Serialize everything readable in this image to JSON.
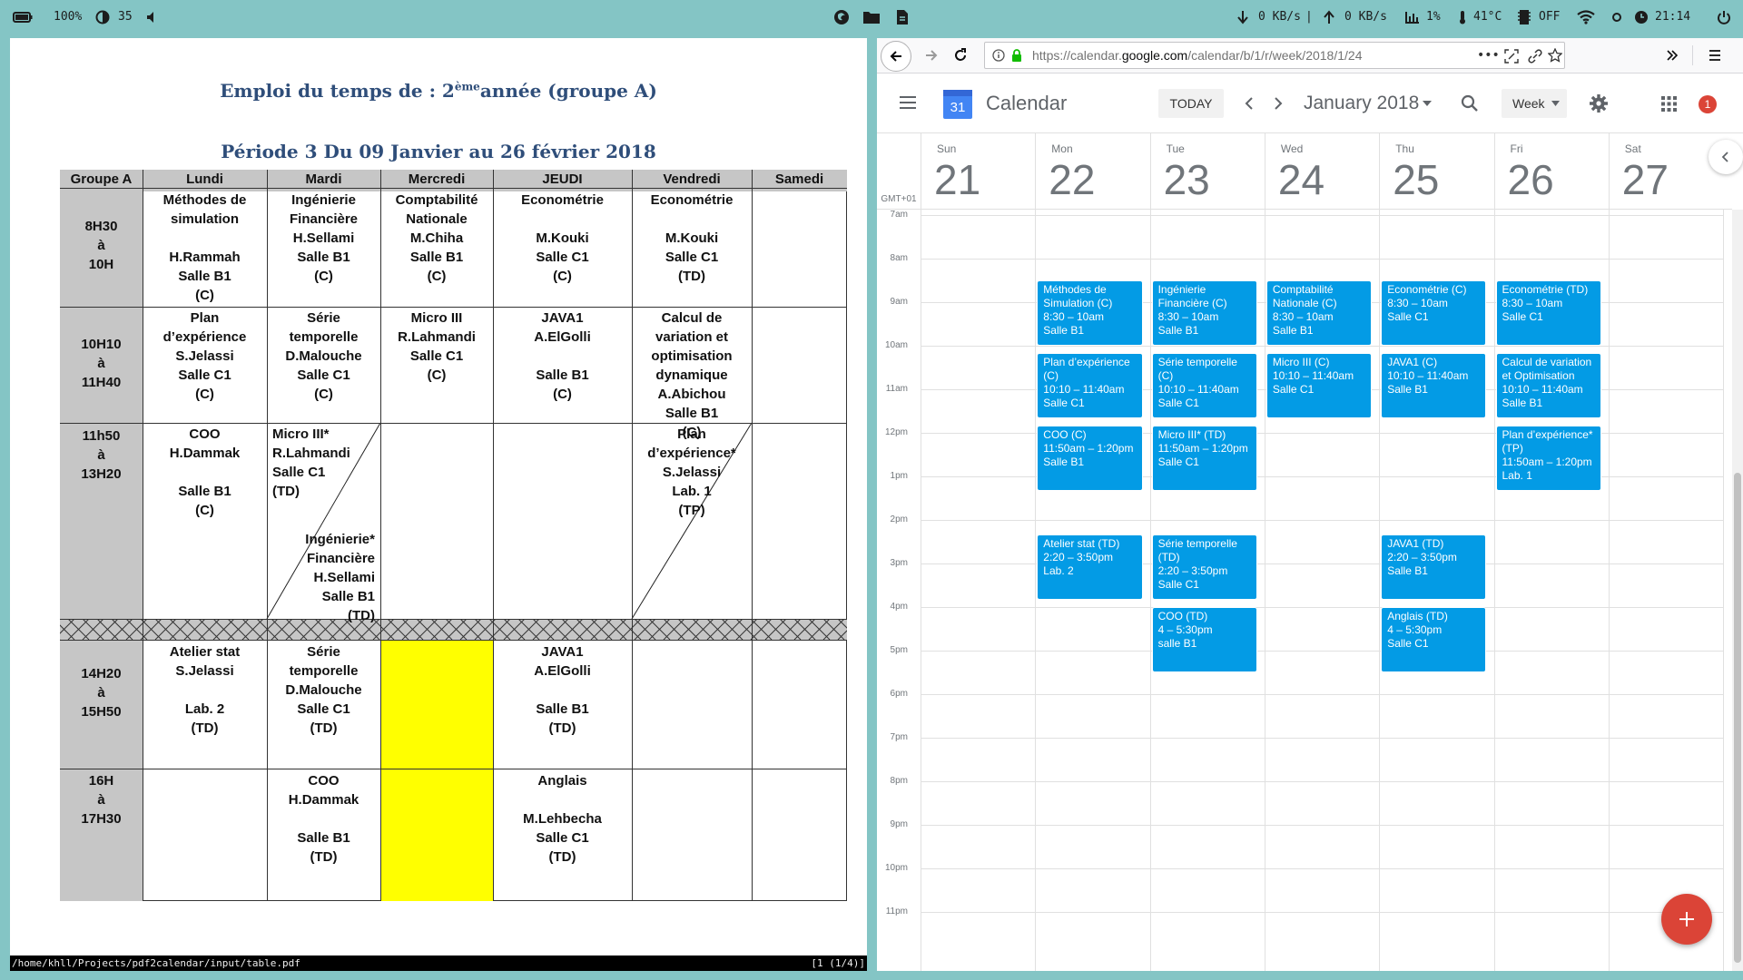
{
  "statusbar": {
    "battery": "100%",
    "brightness": "35",
    "net_down": "0 KB/s",
    "net_sep": "|",
    "net_up": "0 KB/s",
    "cpu": "1%",
    "temp": "41°C",
    "swap": "OFF",
    "clock": "21:14"
  },
  "pdf": {
    "title_prefix": "Emploi du temps de : 2",
    "title_sup": "ème",
    "title_suffix": "année  (groupe A)",
    "period": "Période 3 Du 09 Janvier au 26 février 2018",
    "headers": [
      "Groupe A",
      "Lundi",
      "Mardi",
      "Mercredi",
      "JEUDI",
      "Vendredi",
      "Samedi"
    ],
    "times": [
      "8H30\nà\n10H",
      "10H10\nà\n11H40",
      "11h50\nà\n13H20",
      "14H20\nà\n15H50",
      "16H\nà\n17H30"
    ],
    "cells": {
      "r1_mon": "Méthodes de\nsimulation\n\nH.Rammah\nSalle B1\n(C)",
      "r1_tue": "Ingénierie\nFinancière\nH.Sellami\nSalle B1\n(C)",
      "r1_wed": "Comptabilité\nNationale\nM.Chiha\nSalle B1\n(C)",
      "r1_thu": "Econométrie\n\nM.Kouki\nSalle C1\n(C)",
      "r1_fri": "Econométrie\n\nM.Kouki\nSalle C1\n(TD)",
      "r2_mon": "Plan\nd’expérience\nS.Jelassi\nSalle C1\n(C)",
      "r2_tue": "Série\ntemporelle\nD.Malouche\nSalle C1\n(C)",
      "r2_wed": "Micro III\nR.Lahmandi\nSalle C1\n(C)",
      "r2_thu": "JAVA1\nA.ElGolli\n\nSalle B1\n(C)",
      "r2_fri": "Calcul de\nvariation et\noptimisation\ndynamique\nA.Abichou\nSalle B1\n(C)",
      "r3_mon": "COO\nH.Dammak\n\nSalle B1\n(C)",
      "r3_tue_a": "Micro III*\nR.Lahmandi\nSalle C1\n(TD)",
      "r3_tue_b": "Ingénierie*\nFinancière\nH.Sellami\nSalle B1\n(TD)",
      "r3_fri": "Plan\nd’expérience*\nS.Jelassi\nLab. 1\n(TP)",
      "r4_mon": "Atelier stat\nS.Jelassi\n\nLab. 2\n(TD)",
      "r4_tue": "Série\ntemporelle\nD.Malouche\nSalle C1\n(TD)",
      "r4_thu": "JAVA1\nA.ElGolli\n\nSalle B1\n(TD)",
      "r5_tue": "COO\nH.Dammak\n\nSalle B1\n(TD)",
      "r5_thu": "Anglais\n\nM.Lehbecha\nSalle C1\n(TD)"
    },
    "status_path": "/home/khll/Projects/pdf2calendar/input/table.pdf",
    "status_page": "[1 (1/4)]"
  },
  "browser": {
    "url_prefix": "https://calendar.",
    "url_domain": "google.com",
    "url_suffix": "/calendar/b/1/r/week/2018/1/24"
  },
  "calendar": {
    "app_name": "Calendar",
    "logo_day": "31",
    "today_label": "TODAY",
    "month_label": "January 2018",
    "view_label": "Week",
    "notif_count": "1",
    "timezone": "GMT+01",
    "days": [
      {
        "name": "Sun",
        "num": "21"
      },
      {
        "name": "Mon",
        "num": "22"
      },
      {
        "name": "Tue",
        "num": "23"
      },
      {
        "name": "Wed",
        "num": "24"
      },
      {
        "name": "Thu",
        "num": "25"
      },
      {
        "name": "Fri",
        "num": "26"
      },
      {
        "name": "Sat",
        "num": "27"
      }
    ],
    "hours": [
      "7am",
      "8am",
      "9am",
      "10am",
      "11am",
      "12pm",
      "1pm",
      "2pm",
      "3pm",
      "4pm",
      "5pm",
      "6pm",
      "7pm",
      "8pm",
      "9pm",
      "10pm",
      "11pm"
    ],
    "events": [
      {
        "day": 1,
        "start": 8.5,
        "end": 10,
        "title": "Méthodes de Simulation (C)",
        "time": "8:30 – 10am",
        "loc": "Salle B1"
      },
      {
        "day": 2,
        "start": 8.5,
        "end": 10,
        "title": "Ingénierie Financière (C)",
        "time": "8:30 – 10am",
        "loc": "Salle B1"
      },
      {
        "day": 3,
        "start": 8.5,
        "end": 10,
        "title": "Comptabilité Nationale (C)",
        "time": "8:30 – 10am",
        "loc": "Salle B1"
      },
      {
        "day": 4,
        "start": 8.5,
        "end": 10,
        "title": "Econométrie (C)",
        "time": "8:30 – 10am",
        "loc": "Salle C1"
      },
      {
        "day": 5,
        "start": 8.5,
        "end": 10,
        "title": "Econométrie (TD)",
        "time": "8:30 – 10am",
        "loc": "Salle C1"
      },
      {
        "day": 1,
        "start": 10.17,
        "end": 11.67,
        "title": "Plan d’expérience (C)",
        "time": "10:10 – 11:40am",
        "loc": "Salle C1"
      },
      {
        "day": 2,
        "start": 10.17,
        "end": 11.67,
        "title": "Série temporelle (C)",
        "time": "10:10 – 11:40am",
        "loc": "Salle C1"
      },
      {
        "day": 3,
        "start": 10.17,
        "end": 11.67,
        "title": "Micro III (C)",
        "time": "10:10 – 11:40am",
        "loc": "Salle C1"
      },
      {
        "day": 4,
        "start": 10.17,
        "end": 11.67,
        "title": "JAVA1 (C)",
        "time": "10:10 – 11:40am",
        "loc": "Salle B1"
      },
      {
        "day": 5,
        "start": 10.17,
        "end": 11.67,
        "title": "Calcul de variation et Optimisation",
        "time": "10:10 – 11:40am",
        "loc": "Salle B1"
      },
      {
        "day": 1,
        "start": 11.83,
        "end": 13.33,
        "title": "COO (C)",
        "time": "11:50am – 1:20pm",
        "loc": "Salle B1"
      },
      {
        "day": 2,
        "start": 11.83,
        "end": 13.33,
        "title": "Micro III* (TD)",
        "time": "11:50am – 1:20pm",
        "loc": "Salle C1"
      },
      {
        "day": 5,
        "start": 11.83,
        "end": 13.33,
        "title": "Plan d’expérience* (TP)",
        "time": "11:50am – 1:20pm",
        "loc": "Lab. 1"
      },
      {
        "day": 1,
        "start": 14.33,
        "end": 15.83,
        "title": "Atelier stat (TD)",
        "time": "2:20 – 3:50pm",
        "loc": "Lab. 2"
      },
      {
        "day": 2,
        "start": 14.33,
        "end": 15.83,
        "title": "Série temporelle (TD)",
        "time": "2:20 – 3:50pm",
        "loc": "Salle C1"
      },
      {
        "day": 4,
        "start": 14.33,
        "end": 15.83,
        "title": "JAVA1 (TD)",
        "time": "2:20 – 3:50pm",
        "loc": "Salle B1"
      },
      {
        "day": 2,
        "start": 16,
        "end": 17.5,
        "title": "COO (TD)",
        "time": "4 – 5:30pm",
        "loc": "salle B1"
      },
      {
        "day": 4,
        "start": 16,
        "end": 17.5,
        "title": "Anglais (TD)",
        "time": "4 – 5:30pm",
        "loc": "Salle C1"
      }
    ]
  },
  "colors": {
    "event_blue": "#039be5",
    "fab_red": "#db4437",
    "yellow_cell": "#ffff00",
    "time_column_gray": "#c6c6c6",
    "title_blue": "#2f4e7a"
  }
}
